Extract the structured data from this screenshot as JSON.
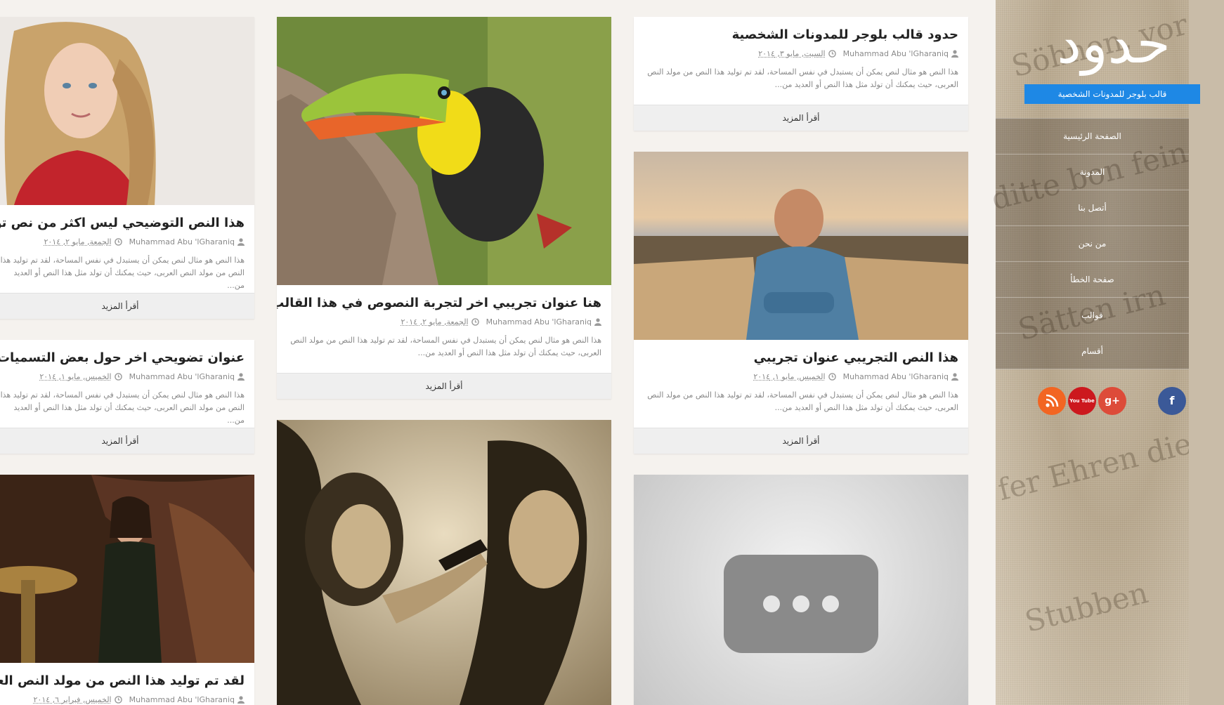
{
  "blog": {
    "title": "حدود",
    "tagline": "قالب بلوجر للمدونات الشخصية"
  },
  "nav": {
    "items": [
      "الصفحة الرئيسية",
      "المدونة",
      "أتصل بنا",
      "من نحن",
      "صفحة الخطأ",
      "قوالب",
      "أقسام"
    ]
  },
  "social": {
    "facebook": "f",
    "googleplus": "g+",
    "youtube": "You Tube",
    "rss": "rss"
  },
  "readmore": "أقرأ المزيد",
  "posts": [
    {
      "title": "حدود قالب بلوجر للمدونات الشخصية",
      "author": "Muhammad Abu 'lGharaniq",
      "date": "السبت, مايو ٣, ٢٠١٤",
      "excerpt": "هذا النص هو مثال لنص يمكن أن يستبدل في نفس المساحة، لقد تم توليد هذا النص من مولد النص العربى، حيث يمكنك أن تولد مثل هذا النص أو العديد من..."
    },
    {
      "title": "هذا النص التجريبي عنوان تجريبي",
      "author": "Muhammad Abu 'lGharaniq",
      "date": "الخميس, مايو ١, ٢٠١٤",
      "excerpt": "هذا النص هو مثال لنص يمكن أن يستبدل في نفس المساحة، لقد تم توليد هذا النص من مولد النص العربى، حيث يمكنك أن تولد مثل هذا النص أو العديد من..."
    },
    {
      "title": "هنا عنوان تجريبي اخر لتجربة النصوص في هذا القالب",
      "author": "Muhammad Abu 'lGharaniq",
      "date": "الجمعة, مايو ٢, ٢٠١٤",
      "excerpt": "هذا النص هو مثال لنص يمكن أن يستبدل في نفس المساحة، لقد تم توليد هذا النص من مولد النص العربى، حيث يمكنك أن تولد مثل هذا النص أو العديد من..."
    },
    {
      "title": "هذا النص التوضيحي ليس اكثر من نص توضيحي",
      "author": "Muhammad Abu 'lGharaniq",
      "date": "الجمعة, مايو ٢, ٢٠١٤",
      "excerpt": "هذا النص هو مثال لنص يمكن أن يستبدل في نفس المساحة، لقد تم توليد هذا النص من مولد النص العربى، حيث يمكنك أن تولد مثل هذا النص أو العديد من..."
    },
    {
      "title": "عنوان تضويحي اخر حول بعض التسميات التوضيحية",
      "author": "Muhammad Abu 'lGharaniq",
      "date": "الخميس, مايو ١, ٢٠١٤",
      "excerpt": "هذا النص هو مثال لنص يمكن أن يستبدل في نفس المساحة، لقد تم توليد هذا النص من مولد النص العربى، حيث يمكنك أن تولد مثل هذا النص أو العديد من..."
    },
    {
      "title": "لقد تم توليد هذا النص من مولد النص العربى",
      "author": "Muhammad Abu 'lGharaniq",
      "date": "الخميس, فبراير ٦, ٢٠١٤"
    }
  ]
}
